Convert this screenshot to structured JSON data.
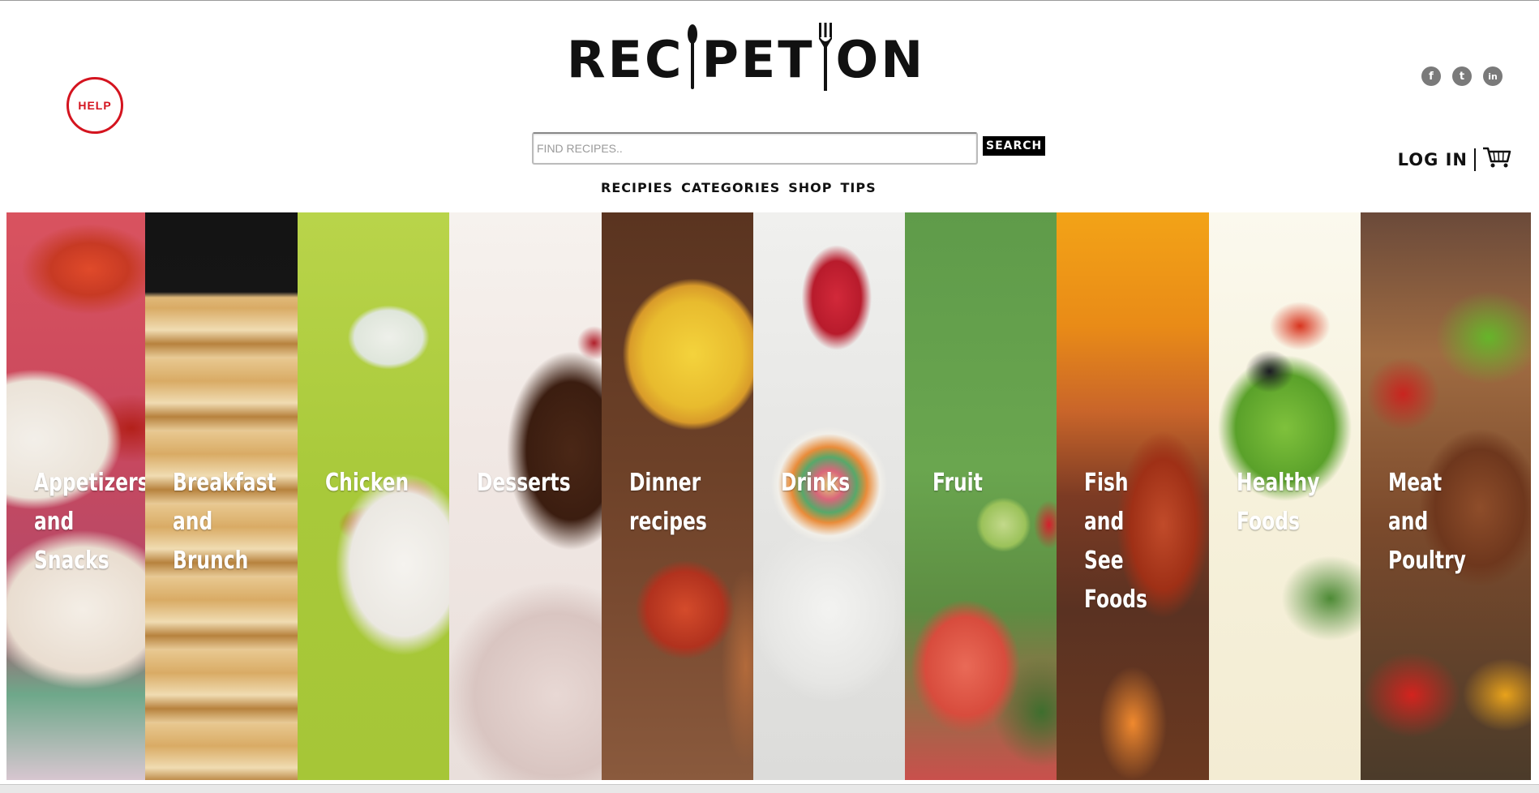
{
  "header": {
    "help_label": "HELP",
    "logo": {
      "part1": "REC",
      "part2": "PET",
      "part3": "ON"
    },
    "social": [
      {
        "name": "facebook-icon",
        "glyph": "f"
      },
      {
        "name": "twitter-icon",
        "glyph": "t"
      },
      {
        "name": "linkedin-icon",
        "glyph": "in"
      }
    ],
    "search": {
      "placeholder": "FIND RECIPES..",
      "value": "",
      "button_label": "SEARCH"
    },
    "nav": [
      "RECIPIES",
      "CATEGORIES",
      "SHOP",
      "TIPS"
    ],
    "login_label": "LOG IN"
  },
  "categories": [
    {
      "label": [
        "Appetizers",
        "and",
        "Snacks"
      ]
    },
    {
      "label": [
        "Breakfast",
        "and",
        "Brunch"
      ]
    },
    {
      "label": [
        "Chicken"
      ]
    },
    {
      "label": [
        "Desserts"
      ]
    },
    {
      "label": [
        "Dinner",
        "recipes"
      ]
    },
    {
      "label": [
        "Drinks"
      ]
    },
    {
      "label": [
        "Fruit"
      ]
    },
    {
      "label": [
        "Fish",
        "and",
        "See",
        "Foods"
      ]
    },
    {
      "label": [
        "Healthy",
        "Foods"
      ]
    },
    {
      "label": [
        "Meat",
        "and",
        "Poultry"
      ]
    }
  ],
  "colors": {
    "help_red": "#d4141f",
    "text_dark": "#111111",
    "social_gray": "#7a7a7a"
  }
}
